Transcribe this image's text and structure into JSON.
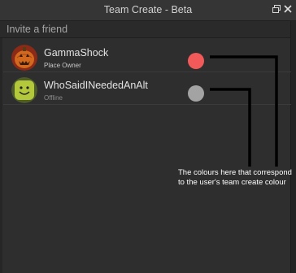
{
  "window": {
    "title": "Team Create - Beta",
    "undock_icon": "undock-icon",
    "close_icon": "close-icon"
  },
  "invite": {
    "placeholder": "Invite a friend"
  },
  "users": [
    {
      "name": "GammaShock",
      "status": "Place Owner",
      "team_color": "#f25a5a",
      "avatar_icon": "pumpkin-avatar"
    },
    {
      "name": "WhoSaidINeededAnAlt",
      "status": "Offline",
      "team_color": "#a3a3a3",
      "avatar_icon": "smiley-avatar"
    }
  ],
  "annotation": {
    "text": "The colours here that correspond to the user's team create colour"
  }
}
